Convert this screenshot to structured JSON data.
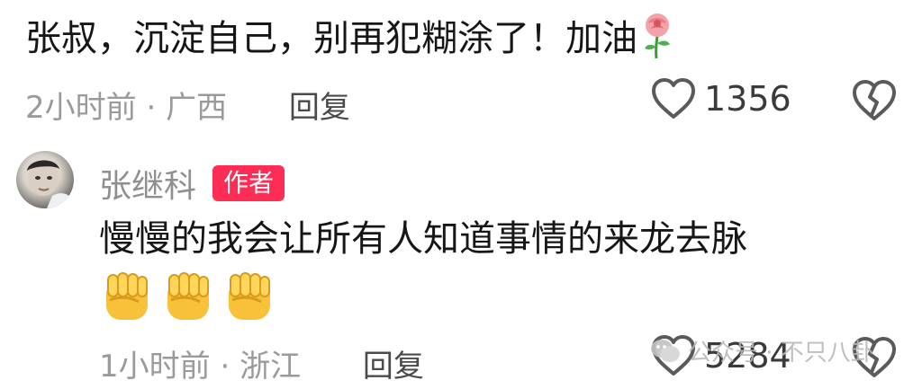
{
  "comments": [
    {
      "text": "张叔，沉淀自己，别再犯糊涂了！加油",
      "emoji": "rose",
      "time": "2小时前",
      "location": "广西",
      "reply_label": "回复",
      "likes": "1356"
    },
    {
      "author": "张继科",
      "badge": "作者",
      "text": "慢慢的我会让所有人知道事情的来龙去脉",
      "emoji": [
        "fist",
        "fist",
        "fist"
      ],
      "time": "1小时前",
      "location": "浙江",
      "reply_label": "回复",
      "likes": "5284"
    }
  ],
  "separator": "·",
  "watermark": {
    "icon": "wechat-icon",
    "text": "公众号 · 不只八卦"
  },
  "colors": {
    "badge": "#ff2c55",
    "meta": "#9a9a9a",
    "text": "#161616"
  }
}
